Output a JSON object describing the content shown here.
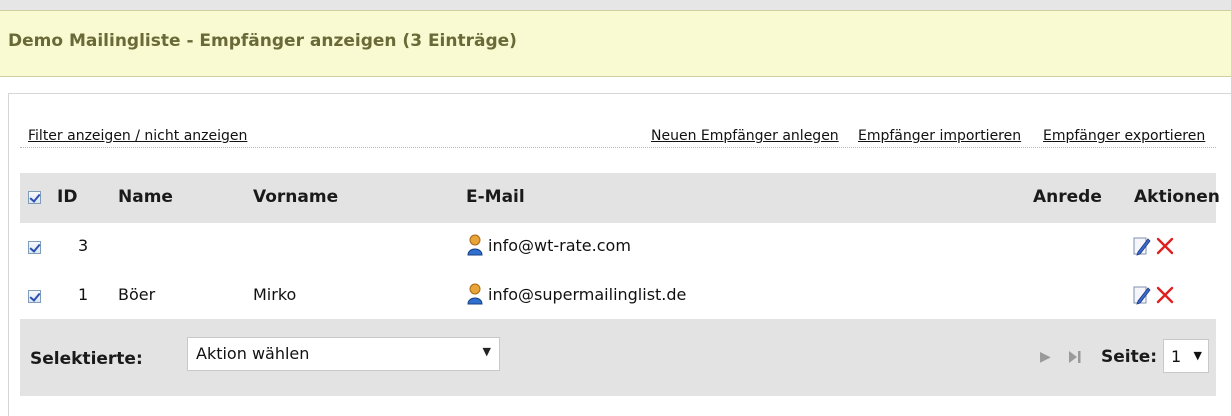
{
  "header": {
    "title": "Demo Mailingliste - Empfänger anzeigen (3 Einträge)"
  },
  "toolbar": {
    "filter_link": "Filter anzeigen / nicht anzeigen",
    "new_link": "Neuen Empfänger anlegen",
    "import_link": "Empfänger importieren",
    "export_link": "Empfänger exportieren"
  },
  "table": {
    "columns": {
      "id": "ID",
      "name": "Name",
      "vorname": "Vorname",
      "email": "E-Mail",
      "anrede": "Anrede",
      "aktionen": "Aktionen"
    },
    "rows": [
      {
        "id": "3",
        "name": "",
        "vorname": "",
        "email": "info@wt-rate.com",
        "anrede": "",
        "checked": true
      },
      {
        "id": "1",
        "name": "Böer",
        "vorname": "Mirko",
        "email": "info@supermailinglist.de",
        "anrede": "",
        "checked": true
      }
    ]
  },
  "footer": {
    "selected_label": "Selektierte:",
    "action_select_value": "Aktion wählen",
    "page_label": "Seite:",
    "page_value": "1"
  },
  "colors": {
    "header_bg": "#fafad2",
    "header_title": "#6a6a38",
    "table_header_bg": "#e3e3e3",
    "delete_red": "#e02020"
  },
  "icons": {
    "person": "user-icon",
    "edit": "pencil-icon",
    "delete": "x-icon",
    "next": "play-icon",
    "last": "skip-end-icon"
  }
}
